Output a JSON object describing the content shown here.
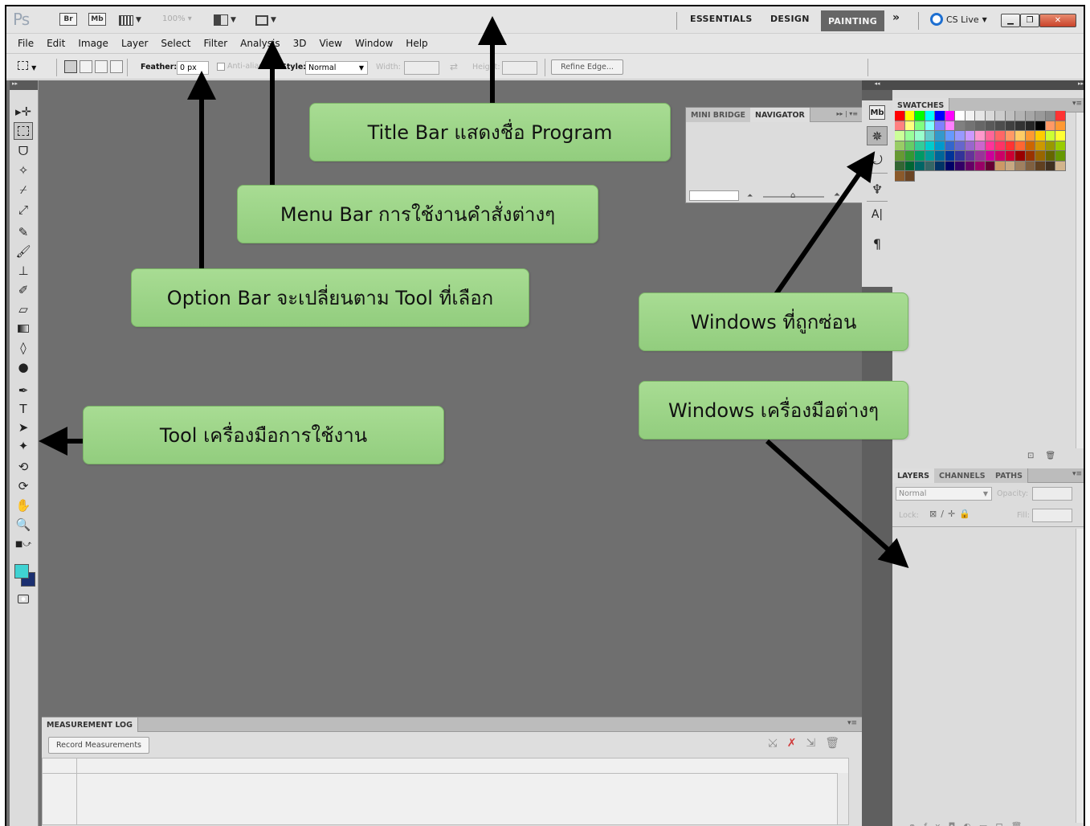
{
  "app": {
    "logo": "Ps",
    "bridge_label": "Br",
    "minibridge_label": "Mb",
    "zoom": "100%",
    "workspaces": {
      "essentials": "ESSENTIALS",
      "design": "DESIGN",
      "painting": "PAINTING",
      "more": "»"
    },
    "cs_live": "CS Live"
  },
  "menu": [
    "File",
    "Edit",
    "Image",
    "Layer",
    "Select",
    "Filter",
    "Analysis",
    "3D",
    "View",
    "Window",
    "Help"
  ],
  "options": {
    "feather_label": "Feather:",
    "feather_value": "0 px",
    "anti_alias_label": "Anti-alias",
    "style_label": "Style:",
    "style_value": "Normal",
    "width_label": "Width:",
    "height_label": "Height:",
    "refine_edge": "Refine Edge..."
  },
  "panels": {
    "mini_bridge_tab": "MINI BRIDGE",
    "navigator_tab": "NAVIGATOR",
    "swatches_tab": "SWATCHES",
    "layers_tab": "LAYERS",
    "channels_tab": "CHANNELS",
    "paths_tab": "PATHS",
    "blend_mode": "Normal",
    "opacity_label": "Opacity:",
    "lock_label": "Lock:",
    "fill_label": "Fill:",
    "measurement_log_tab": "MEASUREMENT LOG",
    "record_measurements": "Record Measurements"
  },
  "callouts": {
    "title_bar": "Title Bar แสดงชื่อ Program",
    "menu_bar": "Menu Bar การใช้งานคำสั่งต่างๆ",
    "option_bar": "Option Bar จะเปลี่ยนตาม Tool ที่เลือก",
    "hidden_windows": "Windows ที่ถูกซ่อน",
    "tools": "Tool เครื่องมือการใช้งาน",
    "panel_windows": "Windows เครื่องมือต่างๆ"
  },
  "colors": {
    "foreground": "#3fd2d2",
    "background": "#1b2f70",
    "callout_fill": "#9fd68a",
    "workspace_bg": "#6f6f6f"
  },
  "swatch_colors": [
    "#ff0000",
    "#ffff00",
    "#00ff00",
    "#00ffff",
    "#0000ff",
    "#ff00ff",
    "#ffffff",
    "#f2f2f2",
    "#e6e6e6",
    "#d9d9d9",
    "#cccccc",
    "#bfbfbf",
    "#b3b3b3",
    "#a6a6a6",
    "#999999",
    "#8c8c8c",
    "#ff3333",
    "#ff8080",
    "#ffff80",
    "#80ff80",
    "#80ffff",
    "#8080ff",
    "#ff80ff",
    "#808080",
    "#737373",
    "#666666",
    "#595959",
    "#4d4d4d",
    "#404040",
    "#333333",
    "#262626",
    "#000000",
    "#ff9966",
    "#ff9933",
    "#ccff99",
    "#99ff99",
    "#99ffcc",
    "#66cccc",
    "#3399cc",
    "#6699ff",
    "#9999ff",
    "#cc99ff",
    "#ff99cc",
    "#ff6699",
    "#ff6666",
    "#ff9966",
    "#ffcc66",
    "#ff9933",
    "#ffcc00",
    "#ccff33",
    "#ffff33",
    "#99cc66",
    "#66cc66",
    "#33cc99",
    "#00cccc",
    "#0099cc",
    "#3366cc",
    "#6666cc",
    "#9966cc",
    "#cc66cc",
    "#ff3399",
    "#ff3366",
    "#ff3333",
    "#ff6633",
    "#cc6600",
    "#cc9900",
    "#999900",
    "#99cc00",
    "#669933",
    "#339933",
    "#009966",
    "#009999",
    "#006699",
    "#003399",
    "#333399",
    "#663399",
    "#993399",
    "#cc0099",
    "#cc0066",
    "#cc0033",
    "#990000",
    "#993300",
    "#996600",
    "#666600",
    "#669900",
    "#336633",
    "#006633",
    "#006666",
    "#336666",
    "#003366",
    "#000066",
    "#330066",
    "#660066",
    "#990066",
    "#660033",
    "#cc9966",
    "#c8a882",
    "#a08060",
    "#806040",
    "#604020",
    "#403020",
    "#d2b48c",
    "#8b5a2b",
    "#6b4423"
  ]
}
